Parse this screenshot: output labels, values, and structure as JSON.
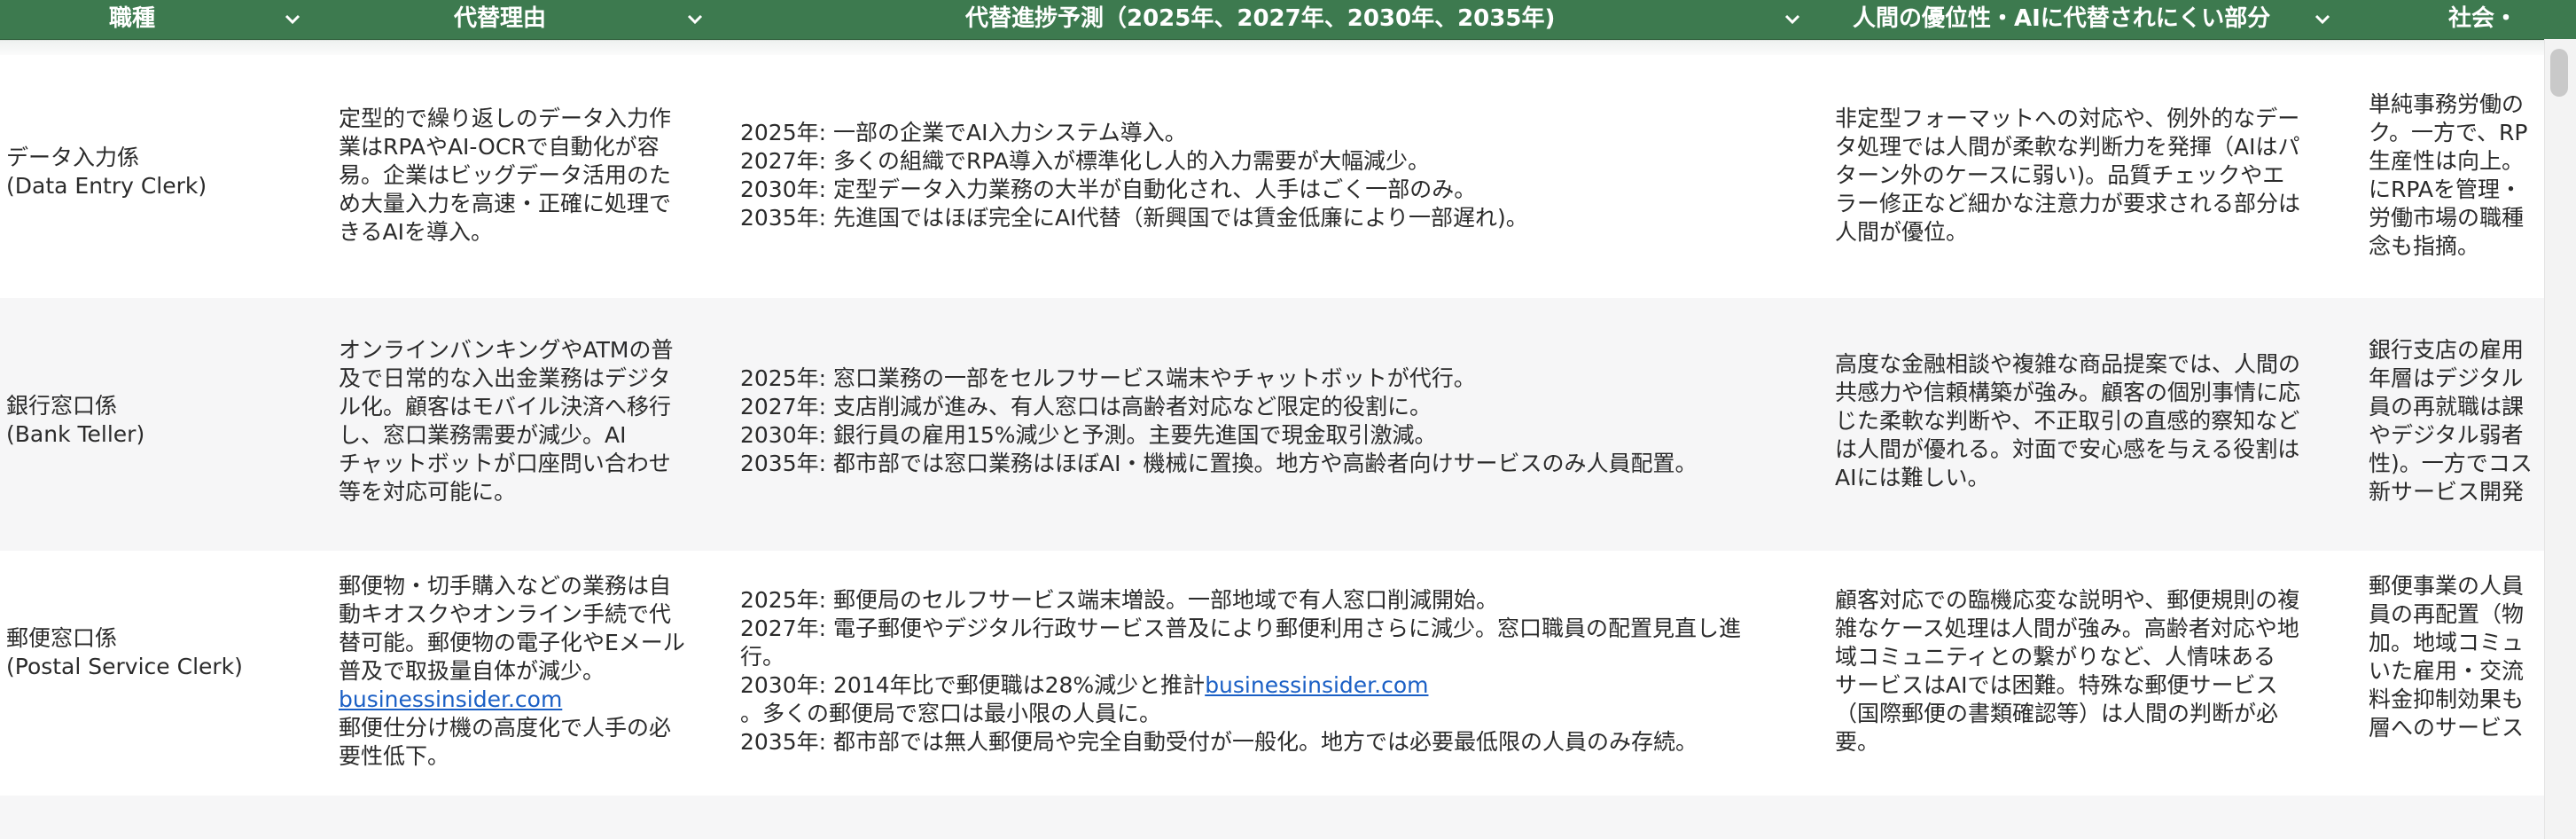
{
  "columns": [
    {
      "label": "職種"
    },
    {
      "label": "代替理由"
    },
    {
      "label": "代替進捗予測（2025年、2027年、2030年、2035年)"
    },
    {
      "label": "人間の優位性・AIに代替されにくい部分"
    },
    {
      "label": "社会・"
    }
  ],
  "rows": [
    {
      "job": "データ入力係\n(Data Entry Clerk)",
      "reason": "定型的で繰り返しのデータ入力作\n業はRPAやAI-OCRで自動化が容\n易。企業はビッグデータ活用のた\nめ大量入力を高速・正確に処理で\nきるAIを導入。",
      "forecast": "2025年: 一部の企業でAI入力システム導入。\n2027年: 多くの組織でRPA導入が標準化し人的入力需要が大幅減少。\n2030年: 定型データ入力業務の大半が自動化され、人手はごく一部のみ。\n2035年: 先進国ではほぼ完全にAI代替（新興国では賃金低廉により一部遅れ)。",
      "advantage": "非定型フォーマットへの対応や、例外的なデー\nタ処理では人間が柔軟な判断力を発揮（AIはパ\nターン外のケースに弱い)。品質チェックやエ\nラー修正など細かな注意力が要求される部分は\n人間が優位。",
      "social": "単純事務労働の\nク。一方で、RP\n生産性は向上。\nにRPAを管理・\n労働市場の職種\n念も指摘。"
    },
    {
      "job": "銀行窓口係\n(Bank Teller)",
      "reason": "オンラインバンキングやATMの普\n及で日常的な入出金業務はデジタ\nル化。顧客はモバイル決済へ移行\nし、窓口業務需要が減少。AI\nチャットボットが口座問い合わせ\n等を対応可能に。",
      "forecast": "2025年: 窓口業務の一部をセルフサービス端末やチャットボットが代行。\n2027年: 支店削減が進み、有人窓口は高齢者対応など限定的役割に。\n2030年: 銀行員の雇用15%減少と予測。主要先進国で現金取引激減。\n2035年: 都市部では窓口業務はほぼAI・機械に置換。地方や高齢者向けサービスのみ人員配置。",
      "advantage": "高度な金融相談や複雑な商品提案では、人間の\n共感力や信頼構築が強み。顧客の個別事情に応\nじた柔軟な判断や、不正取引の直感的察知など\nは人間が優れる。対面で安心感を与える役割は\nAIには難しい。",
      "social": "銀行支店の雇用\n年層はデジタル\n員の再就職は課\nやデジタル弱者\n性)。一方でコス\n新サービス開発"
    },
    {
      "job": "郵便窓口係\n(Postal Service Clerk)",
      "reason_before": "郵便物・切手購入などの業務は自\n動キオスクやオンライン手続で代\n替可能。郵便物の電子化やEメール\n普及で取扱量自体が減少。",
      "reason_link": "businessinsider.com",
      "reason_after": "郵便仕分け機の高度化で人手の必\n要性低下。",
      "forecast_before": "2025年: 郵便局のセルフサービス端末増設。一部地域で有人窓口削減開始。\n2027年: 電子郵便やデジタル行政サービス普及により郵便利用さらに減少。窓口職員の配置見直し進\n行。\n2030年: 2014年比で郵便職は28%減少と推計",
      "forecast_link": "businessinsider.com",
      "forecast_after": "。多くの郵便局で窓口は最小限の人員に。\n2035年: 都市部では無人郵便局や完全自動受付が一般化。地方では必要最低限の人員のみ存続。",
      "advantage": "顧客対応での臨機応変な説明や、郵便規則の複\n雑なケース処理は人間が強み。高齢者対応や地\n域コミュニティとの繋がりなど、人情味ある\nサービスはAIでは困難。特殊な郵便サービス\n（国際郵便の書類確認等）は人間の判断が必\n要。",
      "social": "郵便事業の人員\n員の再配置（物\n加。地域コミュ\nいた雇用・交流\n料金抑制効果も\n層へのサービス"
    }
  ],
  "colors": {
    "header_bg": "#3d7a4f",
    "header_text": "#ffffff",
    "link": "#1a5fc5",
    "row_alt": "#f6f6f7"
  },
  "icons": [
    "chevron-down-icon"
  ]
}
